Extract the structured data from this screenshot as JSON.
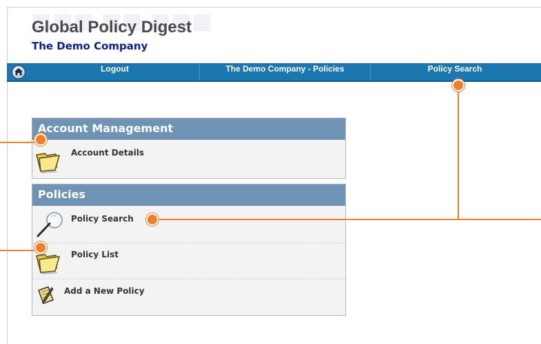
{
  "header": {
    "app_title": "Global Policy Digest",
    "company_name": "The Demo Company"
  },
  "navbar": {
    "home_icon": "home-icon",
    "items": [
      {
        "label": "Logout"
      },
      {
        "label": "The Demo Company - Policies"
      },
      {
        "label": "Policy Search"
      }
    ]
  },
  "panels": {
    "account": {
      "title": "Account Management",
      "items": [
        {
          "label": "Account Details",
          "icon": "folder-icon"
        }
      ]
    },
    "policies": {
      "title": "Policies",
      "items": [
        {
          "label": "Policy Search",
          "icon": "magnifier-icon"
        },
        {
          "label": "Policy List",
          "icon": "folder-icon"
        },
        {
          "label": "Add a New Policy",
          "icon": "notepad-pencil-icon"
        }
      ]
    }
  },
  "colors": {
    "nav_bar": "#1b77b0",
    "panel_header": "#6f93b5",
    "callout": "#ef7f2a",
    "company_text": "#0d1e8c"
  }
}
